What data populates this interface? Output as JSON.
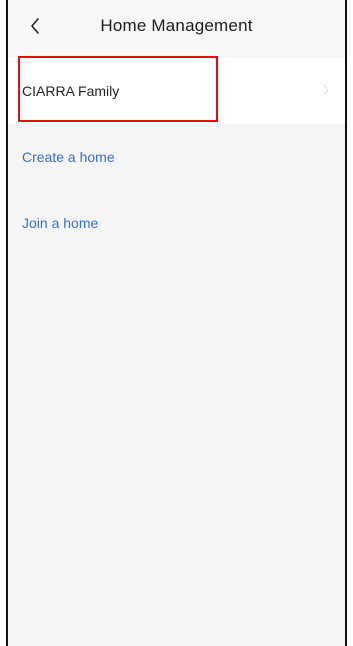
{
  "header": {
    "title": "Home Management"
  },
  "homes": [
    {
      "name": "CIARRA Family"
    }
  ],
  "actions": {
    "create_label": "Create a home",
    "join_label": "Join a home"
  },
  "colors": {
    "action_link": "#3b6ec4",
    "highlight_border": "#e01010",
    "page_background": "#f4f5f7"
  },
  "icons": {
    "back": "chevron-left-icon",
    "row_arrow": "chevron-right-icon"
  }
}
